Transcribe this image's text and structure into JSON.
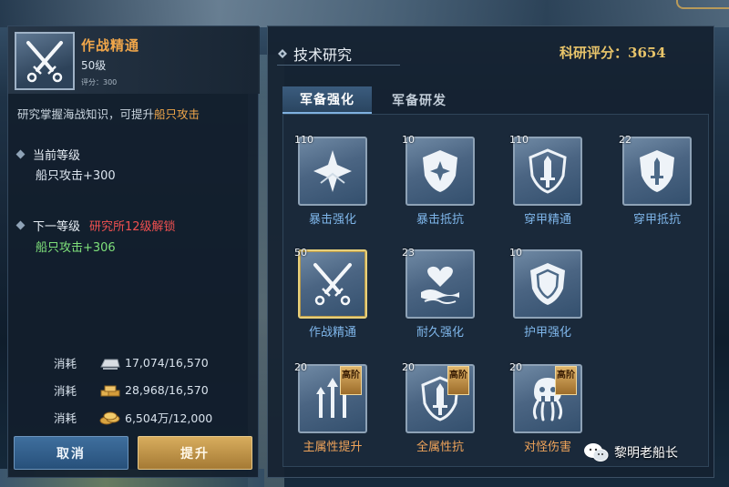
{
  "left": {
    "skill_name": "作战精通",
    "skill_level": "50级",
    "skill_score": "评分：300",
    "description_prefix": "研究掌握海战知识，可提升",
    "description_highlight": "船只攻击",
    "current_level_label": "当前等级",
    "current_value": "船只攻击+300",
    "next_level_label": "下一等级",
    "next_unlock": "研究所12级解锁",
    "next_value": "船只攻击+306",
    "costs": [
      {
        "label": "消耗",
        "icon": "silver-ingot-icon",
        "value": "17,074/16,570"
      },
      {
        "label": "消耗",
        "icon": "gold-bars-icon",
        "value": "28,968/16,570"
      },
      {
        "label": "消耗",
        "icon": "coins-icon",
        "value": "6,504万/12,000"
      }
    ],
    "cancel_label": "取消",
    "upgrade_label": "提升"
  },
  "right": {
    "title": "技术研究",
    "score": "科研评分：3654",
    "tabs": [
      "军备强化",
      "军备研发"
    ],
    "nodes": [
      {
        "level": "110",
        "label": "暴击强化",
        "icon": "starburst-icon"
      },
      {
        "level": "10",
        "label": "暴击抵抗",
        "icon": "star-shield-icon"
      },
      {
        "level": "110",
        "label": "穿甲精通",
        "icon": "sword-shield-icon"
      },
      {
        "level": "22",
        "label": "穿甲抵抗",
        "icon": "sword-shield-icon"
      },
      {
        "level": "50",
        "label": "作战精通",
        "icon": "crossed-swords-icon"
      },
      {
        "level": "23",
        "label": "耐久强化",
        "icon": "heart-wave-icon"
      },
      {
        "level": "10",
        "label": "护甲强化",
        "icon": "shield-icon"
      },
      {
        "level": "20",
        "label": "主属性提升",
        "icon": "arrows-up-icon",
        "badge": "高阶"
      },
      {
        "level": "20",
        "label": "全属性抗",
        "icon": "sword-shield-icon",
        "badge": "高阶"
      },
      {
        "level": "20",
        "label": "对怪伤害",
        "icon": "kraken-icon",
        "badge": "高阶"
      }
    ]
  },
  "watermark": "黎明老船长",
  "colors": {
    "accent_gold": "#f0a64a",
    "label_blue": "#7fb6ea",
    "next_green": "#7ee07a",
    "unlock_red": "#f05050"
  }
}
